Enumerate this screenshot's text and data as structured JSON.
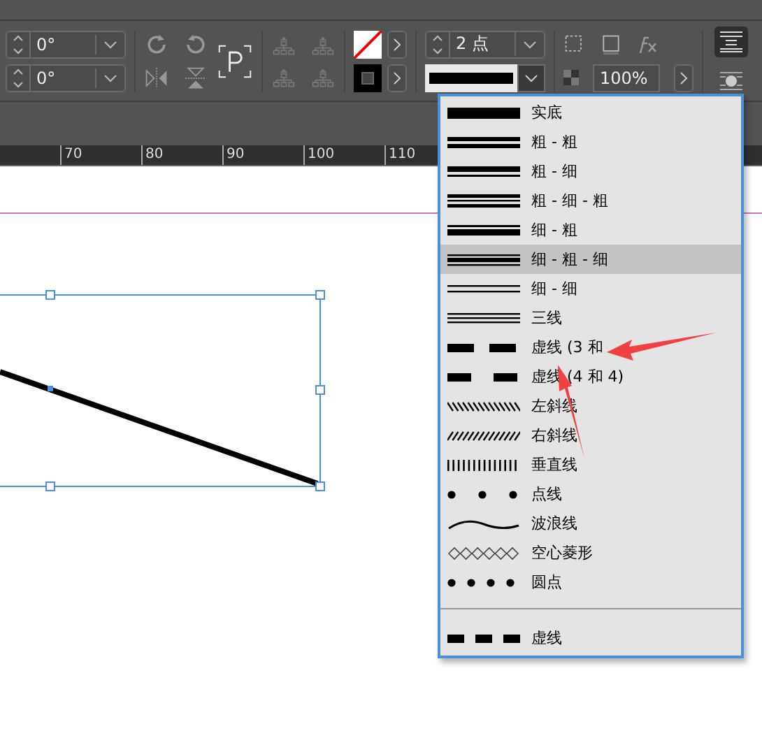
{
  "toolbar": {
    "rotation_fields": [
      {
        "value": "0°"
      },
      {
        "value": "0°"
      }
    ],
    "stroke_weight": {
      "value": "2 点"
    },
    "opacity": {
      "value": "100%"
    }
  },
  "ruler": {
    "labels": [
      "70",
      "80",
      "90",
      "100",
      "110"
    ]
  },
  "stroke_type_menu": {
    "items": [
      {
        "label": "实底",
        "kind": "solid",
        "selected": false
      },
      {
        "label": "粗 - 粗",
        "kind": "thick-thick",
        "selected": false
      },
      {
        "label": "粗 - 细",
        "kind": "thick-thin",
        "selected": false
      },
      {
        "label": "粗 - 细 - 粗",
        "kind": "thick-thin-thick",
        "selected": false
      },
      {
        "label": "细 - 粗",
        "kind": "thin-thick",
        "selected": false
      },
      {
        "label": "细 - 粗 - 细",
        "kind": "thin-thick-thin",
        "selected": true
      },
      {
        "label": "细 - 细",
        "kind": "thin-thin",
        "selected": false
      },
      {
        "label": "三线",
        "kind": "triple",
        "selected": false
      },
      {
        "label": "虚线 (3 和",
        "kind": "dash-3-2",
        "selected": false
      },
      {
        "label": "虚线 (4 和 4)",
        "kind": "dash-4-4",
        "selected": false
      },
      {
        "label": "左斜线",
        "kind": "left-hatch",
        "selected": false
      },
      {
        "label": "右斜线",
        "kind": "right-hatch",
        "selected": false
      },
      {
        "label": "垂直线",
        "kind": "vertical",
        "selected": false
      },
      {
        "label": "点线",
        "kind": "dotted",
        "selected": false
      },
      {
        "label": "波浪线",
        "kind": "wavy",
        "selected": false
      },
      {
        "label": "空心菱形",
        "kind": "diamond",
        "selected": false
      },
      {
        "label": "圆点",
        "kind": "dots",
        "selected": false
      }
    ],
    "custom_items": [
      {
        "label": "虚线",
        "kind": "dash",
        "selected": false
      }
    ]
  }
}
